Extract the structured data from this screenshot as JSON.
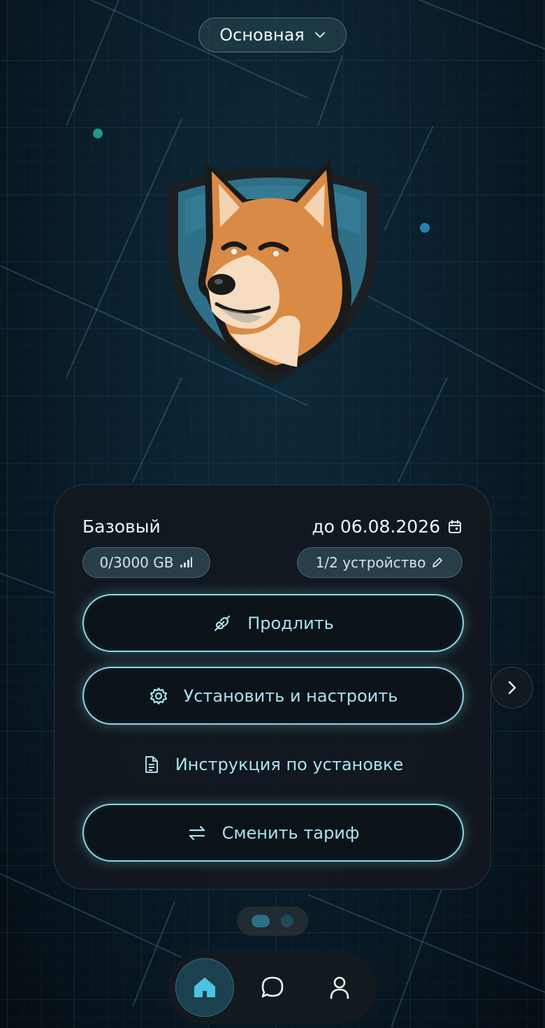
{
  "header": {
    "plan_selector_label": "Основная"
  },
  "subscription": {
    "plan_name": "Базовый",
    "expires": "до 06.08.2026",
    "traffic": "0/3000 GB",
    "devices": "1/2 устройство"
  },
  "actions": {
    "renew_label": "Продлить",
    "setup_label": "Установить и настроить",
    "instructions_label": "Инструкция по установке",
    "change_tariff_label": "Сменить тариф"
  },
  "icons": {
    "plan_selector": "chevron-down-icon",
    "expires": "calendar-icon",
    "traffic": "signal-bars-icon",
    "devices": "pencil-icon",
    "renew": "plug-icon",
    "setup": "gear-icon",
    "instructions": "document-icon",
    "change_tariff": "swap-arrows-icon",
    "next": "chevron-right-icon",
    "nav_home": "home-icon",
    "nav_chat": "chat-bubble-icon",
    "nav_profile": "user-icon"
  },
  "pager": {
    "total_pages": 2,
    "active_page": 1
  },
  "colors": {
    "accent": "#8fd6e4",
    "card_bg": "#12181e",
    "background": "#0a1f2c"
  }
}
